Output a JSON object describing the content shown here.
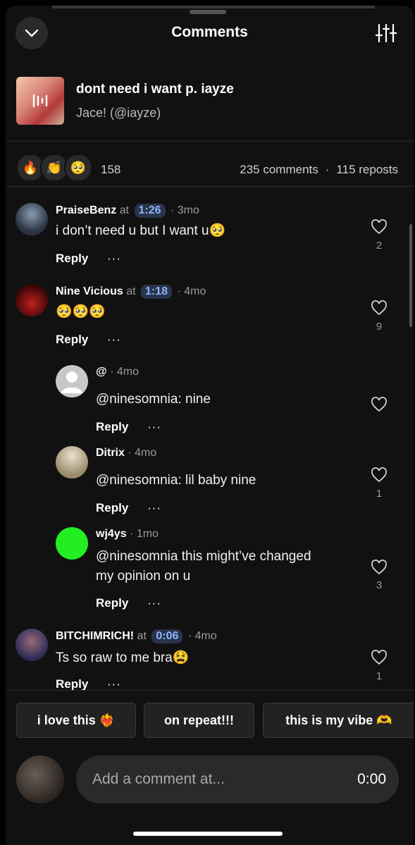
{
  "header": {
    "title": "Comments",
    "back_icon": "chevron-down-icon",
    "filter_icon": "sliders-icon"
  },
  "track": {
    "title": "dont need i want p. iayze",
    "artist": "Jace! (@iayze)"
  },
  "stats": {
    "reactions": [
      "🔥",
      "👏",
      "🥺"
    ],
    "reaction_count": "158",
    "comments": "235 comments",
    "separator": "·",
    "reposts": "115 reposts"
  },
  "comments": [
    {
      "user": "PraiseBenz",
      "at": "at",
      "timestamp": "1:26",
      "age": "· 3mo",
      "text": "i don’t need u but I want u🥺",
      "reply": "Reply",
      "more": "···",
      "likes": "2"
    },
    {
      "user": "Nine Vicious",
      "at": "at",
      "timestamp": "1:18",
      "age": "· 4mo",
      "text": "🥺🥺🥺",
      "reply": "Reply",
      "more": "···",
      "likes": "9"
    },
    {
      "user": "@",
      "age": "· 4mo",
      "text": "@ninesomnia: nine",
      "reply": "Reply",
      "more": "···",
      "likes": ""
    },
    {
      "user": "Ditrix",
      "age": "· 4mo",
      "text": "@ninesomnia: lil baby nine",
      "reply": "Reply",
      "more": "···",
      "likes": "1"
    },
    {
      "user": "wj4ys",
      "age": "· 1mo",
      "text_line1": "@ninesomnia this might’ve changed",
      "text_line2": "my opinion on u",
      "reply": "Reply",
      "more": "···",
      "likes": "3"
    },
    {
      "user": "BITCHIMRICH!",
      "at": "at",
      "timestamp": "0:06",
      "age": "· 4mo",
      "text": "Ts so raw to me bra😫",
      "reply": "Reply",
      "more": "···",
      "likes": "1"
    }
  ],
  "quick_replies": [
    "i love this ❤️‍🔥",
    "on repeat!!!",
    "this is my vibe 🫶"
  ],
  "composer": {
    "placeholder": "Add a comment at...",
    "time": "0:00"
  },
  "colors": {
    "background": "#111111",
    "timestamp_bg": "#283449",
    "timestamp_text": "#8fb3ff",
    "green_avatar": "#22ee22"
  }
}
